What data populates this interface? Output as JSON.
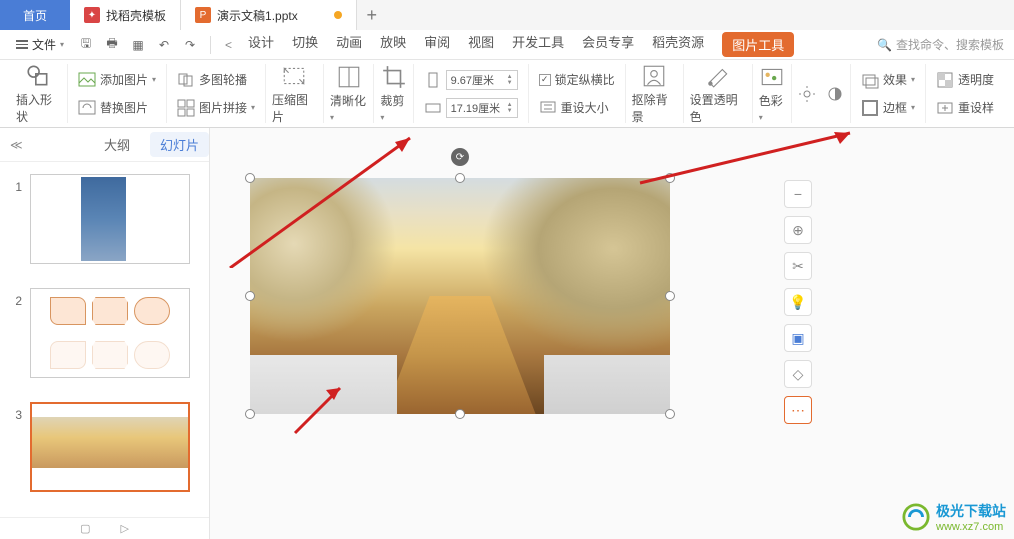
{
  "tabs": {
    "home": "首页",
    "docer": "找稻壳模板",
    "file": "演示文稿1.pptx",
    "add": "+"
  },
  "menu": {
    "file_label": "文件",
    "tabs": [
      "设计",
      "切换",
      "动画",
      "放映",
      "审阅",
      "视图",
      "开发工具",
      "会员专享",
      "稻壳资源"
    ],
    "pic_tool": "图片工具",
    "search_placeholder": "查找命令、搜索模板"
  },
  "toolbar": {
    "insert_shape": "插入形状",
    "add_image": "添加图片",
    "multi_rotate": "多图轮播",
    "replace_image": "替换图片",
    "image_stitch": "图片拼接",
    "compress": "压缩图片",
    "clarify": "清晰化",
    "crop": "裁剪",
    "height": "9.67厘米",
    "width": "17.19厘米",
    "lock_ratio": "锁定纵横比",
    "reset_size": "重设大小",
    "remove_bg": "抠除背景",
    "set_transparent": "设置透明色",
    "color": "色彩",
    "effect": "效果",
    "transparency": "透明度",
    "border": "边框",
    "reset_style": "重设样"
  },
  "panel": {
    "outline": "大纲",
    "slides": "幻灯片",
    "nums": [
      "1",
      "2",
      "3"
    ]
  },
  "watermark": {
    "cn": "极光下载站",
    "url": "www.xz7.com"
  }
}
